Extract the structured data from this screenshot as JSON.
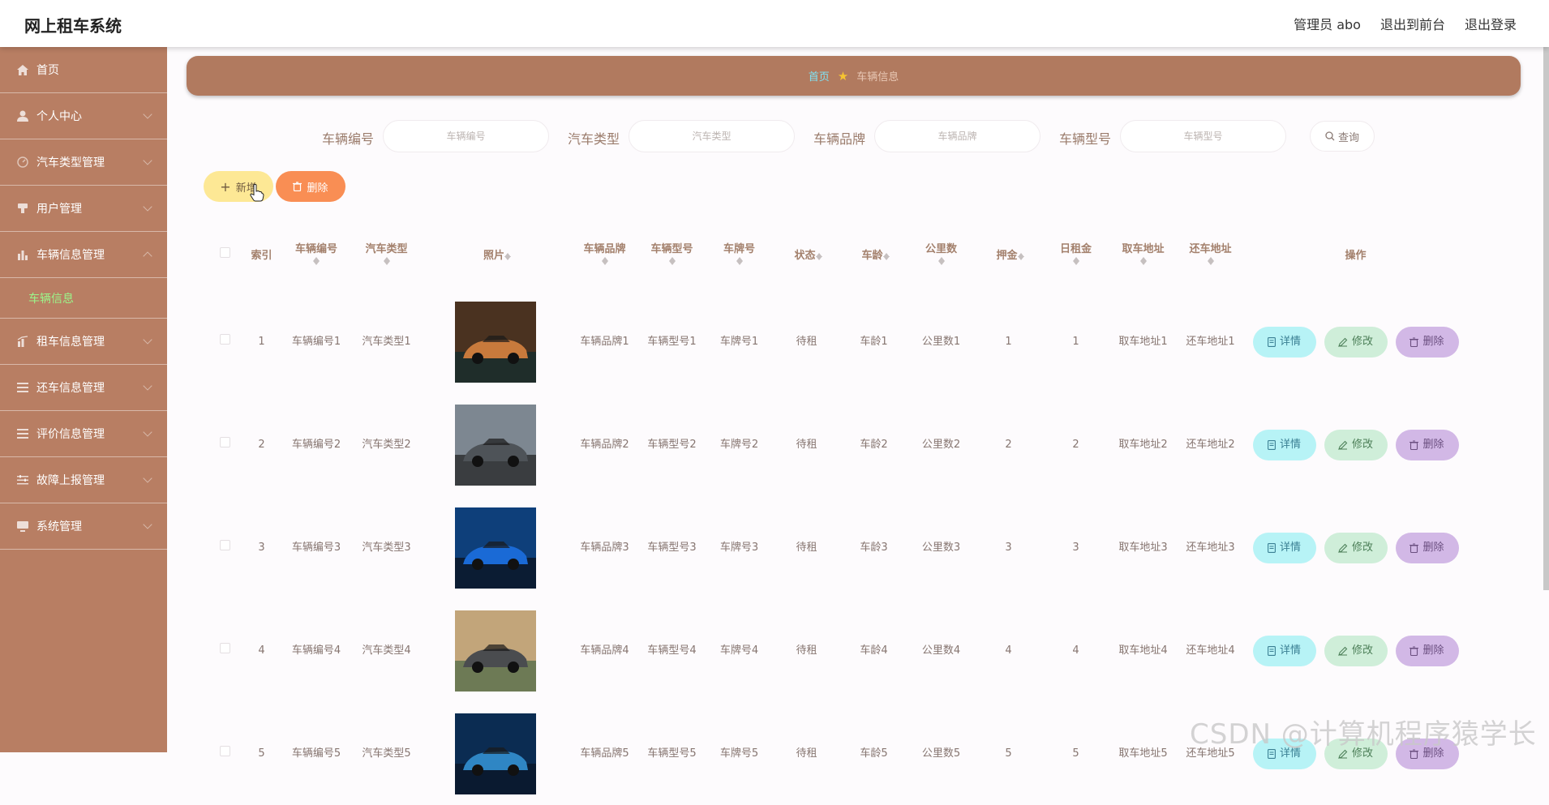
{
  "app": {
    "title": "网上租车系统",
    "top_links": [
      "管理员 abo",
      "退出到前台",
      "退出登录"
    ]
  },
  "sidebar": {
    "items": [
      {
        "label": "首页",
        "icon": "home-icon"
      },
      {
        "label": "个人中心",
        "icon": "user-icon"
      },
      {
        "label": "汽车类型管理",
        "icon": "gauge-icon"
      },
      {
        "label": "用户管理",
        "icon": "stamp-icon"
      },
      {
        "label": "车辆信息管理",
        "icon": "bar-chart-icon"
      },
      {
        "label": "租车信息管理",
        "icon": "chart-icon"
      },
      {
        "label": "还车信息管理",
        "icon": "list-icon"
      },
      {
        "label": "评价信息管理",
        "icon": "list-icon"
      },
      {
        "label": "故障上报管理",
        "icon": "sliders-icon"
      },
      {
        "label": "系统管理",
        "icon": "monitor-icon"
      }
    ],
    "active_sub": "车辆信息"
  },
  "breadcrumb": {
    "home": "首页",
    "current": "车辆信息"
  },
  "search": {
    "fields": [
      {
        "label": "车辆编号",
        "placeholder": "车辆编号"
      },
      {
        "label": "汽车类型",
        "placeholder": "汽车类型"
      },
      {
        "label": "车辆品牌",
        "placeholder": "车辆品牌"
      },
      {
        "label": "车辆型号",
        "placeholder": "车辆型号"
      }
    ],
    "query_label": "查询"
  },
  "actions": {
    "add_label": "新增",
    "delete_label": "删除"
  },
  "table": {
    "headers": {
      "index": "索引",
      "vehicle_no": "车辆编号",
      "car_type": "汽车类型",
      "photo": "照片",
      "brand": "车辆品牌",
      "model": "车辆型号",
      "plate": "车牌号",
      "status": "状态",
      "age": "车龄",
      "mileage": "公里数",
      "deposit": "押金",
      "daily_rent": "日租金",
      "pickup": "取车地址",
      "return": "还车地址",
      "ops": "操作"
    },
    "rows": [
      {
        "index": "1",
        "vehicle_no": "车辆编号1",
        "car_type": "汽车类型1",
        "brand": "车辆品牌1",
        "model": "车辆型号1",
        "plate": "车牌号1",
        "status": "待租",
        "age": "车龄1",
        "mileage": "公里数1",
        "deposit": "1",
        "daily_rent": "1",
        "pickup": "取车地址1",
        "return": "还车地址1",
        "photo_colors": [
          "#4a3220",
          "#c87a3c",
          "#1f2d2a"
        ]
      },
      {
        "index": "2",
        "vehicle_no": "车辆编号2",
        "car_type": "汽车类型2",
        "brand": "车辆品牌2",
        "model": "车辆型号2",
        "plate": "车牌号2",
        "status": "待租",
        "age": "车龄2",
        "mileage": "公里数2",
        "deposit": "2",
        "daily_rent": "2",
        "pickup": "取车地址2",
        "return": "还车地址2",
        "photo_colors": [
          "#7d8791",
          "#4e5358",
          "#3a3d40"
        ]
      },
      {
        "index": "3",
        "vehicle_no": "车辆编号3",
        "car_type": "汽车类型3",
        "brand": "车辆品牌3",
        "model": "车辆型号3",
        "plate": "车牌号3",
        "status": "待租",
        "age": "车龄3",
        "mileage": "公里数3",
        "deposit": "3",
        "daily_rent": "3",
        "pickup": "取车地址3",
        "return": "还车地址3",
        "photo_colors": [
          "#0e3f7a",
          "#1a6ad6",
          "#0b1c33"
        ]
      },
      {
        "index": "4",
        "vehicle_no": "车辆编号4",
        "car_type": "汽车类型4",
        "brand": "车辆品牌4",
        "model": "车辆型号4",
        "plate": "车牌号4",
        "status": "待租",
        "age": "车龄4",
        "mileage": "公里数4",
        "deposit": "4",
        "daily_rent": "4",
        "pickup": "取车地址4",
        "return": "还车地址4",
        "photo_colors": [
          "#c2a57a",
          "#4a4c4f",
          "#6d7a55"
        ]
      },
      {
        "index": "5",
        "vehicle_no": "车辆编号5",
        "car_type": "汽车类型5",
        "brand": "车辆品牌5",
        "model": "车辆型号5",
        "plate": "车牌号5",
        "status": "待租",
        "age": "车龄5",
        "mileage": "公里数5",
        "deposit": "5",
        "daily_rent": "5",
        "pickup": "取车地址5",
        "return": "还车地址5",
        "photo_colors": [
          "#0b2c52",
          "#2f86c4",
          "#0a1a30"
        ]
      }
    ],
    "op_labels": {
      "detail": "详情",
      "edit": "修改",
      "remove": "删除"
    }
  },
  "watermark": "CSDN @计算机程序猿学长"
}
